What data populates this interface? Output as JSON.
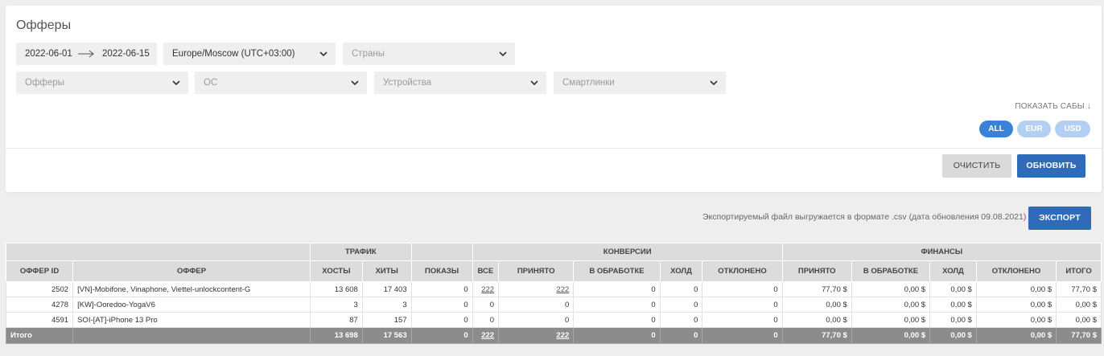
{
  "title": "Офферы",
  "filters": {
    "date_from": "2022-06-01",
    "date_to": "2022-06-15",
    "timezone": "Europe/Moscow (UTC+03:00)",
    "countries_placeholder": "Страны",
    "offers_placeholder": "Офферы",
    "os_placeholder": "ОС",
    "devices_placeholder": "Устройства",
    "smartlinks_placeholder": "Смартлинки"
  },
  "show_subs": "ПОКАЗАТЬ САБЫ",
  "currency": {
    "all": "ALL",
    "eur": "EUR",
    "usd": "USD",
    "selected": "ALL"
  },
  "buttons": {
    "clear": "ОЧИСТИТЬ",
    "update": "ОБНОВИТЬ",
    "export": "ЭКСПОРТ"
  },
  "export_note": "Экспортируемый файл выгружается в формате .csv (дата обновления 09.08.2021)",
  "colors": {
    "primary": "#2f6bb8",
    "pill_active": "#3a82d6",
    "pill_inactive": "#b3d0f2"
  },
  "table": {
    "groups": {
      "traffic": "ТРАФИК",
      "conversions": "КОНВЕРСИИ",
      "finance": "ФИНАНСЫ"
    },
    "columns": [
      "ОФФЕР ID",
      "ОФФЕР",
      "ХОСТЫ",
      "ХИТЫ",
      "ПОКАЗЫ",
      "ВСЕ",
      "ПРИНЯТО",
      "В ОБРАБОТКЕ",
      "ХОЛД",
      "ОТКЛОНЕНО",
      "ПРИНЯТО",
      "В ОБРАБОТКЕ",
      "ХОЛД",
      "ОТКЛОНЕНО",
      "ИТОГО"
    ],
    "rows": [
      [
        "2502",
        "[VN]-Mobifone, Vinaphone, Viettel-unlockcontent-G",
        "13 608",
        "17 403",
        "0",
        "222",
        "222",
        "0",
        "0",
        "0",
        "77,70 $",
        "0,00 $",
        "0,00 $",
        "0,00 $",
        "77,70 $"
      ],
      [
        "4278",
        "[KW]-Ooredoo-YogaV6",
        "3",
        "3",
        "0",
        "0",
        "0",
        "0",
        "0",
        "0",
        "0,00 $",
        "0,00 $",
        "0,00 $",
        "0,00 $",
        "0,00 $"
      ],
      [
        "4591",
        "SOI-[AT]-iPhone 13 Pro",
        "87",
        "157",
        "0",
        "0",
        "0",
        "0",
        "0",
        "0",
        "0,00 $",
        "0,00 $",
        "0,00 $",
        "0,00 $",
        "0,00 $"
      ]
    ],
    "total": [
      "Итого",
      "",
      "13 698",
      "17 563",
      "0",
      "222",
      "222",
      "0",
      "0",
      "0",
      "77,70 $",
      "0,00 $",
      "0,00 $",
      "0,00 $",
      "77,70 $"
    ]
  }
}
